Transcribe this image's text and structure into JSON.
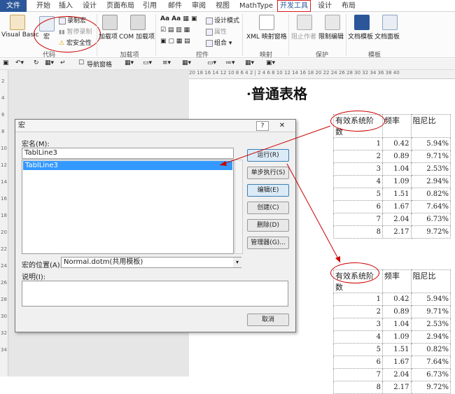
{
  "menu": {
    "file": "文件",
    "tabs": [
      "开始",
      "插入",
      "设计",
      "页面布局",
      "引用",
      "邮件",
      "审阅",
      "视图",
      "MathType",
      "开发工具",
      "设计",
      "布局"
    ]
  },
  "ribbon": {
    "code": {
      "visual_basic": "Visual Basic",
      "macro": "宏",
      "record_macro": "录制宏",
      "pause_recording": "暂停录制",
      "macro_security": "宏安全性",
      "label": "代码"
    },
    "addins": {
      "addins": "加载项",
      "com_addins": "COM 加载项",
      "label": "加载项"
    },
    "controls": {
      "design_mode": "设计模式",
      "properties": "属性",
      "group": "组合",
      "label": "控件"
    },
    "mapping": {
      "xml_pane": "XML 映射窗格",
      "label": "映射"
    },
    "protect": {
      "block_authors": "阻止作者",
      "restrict_editing": "限制编辑",
      "label": "保护"
    },
    "templates": {
      "doc_template": "文档模板",
      "doc_panel": "文档面板",
      "label": "模板"
    }
  },
  "qat": {
    "nav_pane": "导航窗格"
  },
  "ruler": {
    "h": "20 18 16 14 12 10 8 6 4 2 | 2 4 6 8 10 12 14 16 18 20 22 24 26 28 30 32 34 36 38 40",
    "v": [
      "2",
      "4",
      "6",
      "8",
      "10",
      "12",
      "14",
      "16",
      "18",
      "20",
      "22",
      "24",
      "26",
      "28",
      "30",
      "32",
      "34"
    ]
  },
  "document": {
    "title": "·普通表格",
    "tables": [
      {
        "headers": [
          "有效系统阶数",
          "频率",
          "阻尼比"
        ],
        "rows": [
          [
            "1",
            "0.42",
            "5.94%"
          ],
          [
            "2",
            "0.89",
            "9.71%"
          ],
          [
            "3",
            "1.04",
            "2.53%"
          ],
          [
            "4",
            "1.09",
            "2.94%"
          ],
          [
            "5",
            "1.51",
            "0.82%"
          ],
          [
            "6",
            "1.67",
            "7.64%"
          ],
          [
            "7",
            "2.04",
            "6.73%"
          ],
          [
            "8",
            "2.17",
            "9.72%"
          ]
        ]
      },
      {
        "headers": [
          "有效系统阶数",
          "频率",
          "阻尼比"
        ],
        "rows": [
          [
            "1",
            "0.42",
            "5.94%"
          ],
          [
            "2",
            "0.89",
            "9.71%"
          ],
          [
            "3",
            "1.04",
            "2.53%"
          ],
          [
            "4",
            "1.09",
            "2.94%"
          ],
          [
            "5",
            "1.51",
            "0.82%"
          ],
          [
            "6",
            "1.67",
            "7.64%"
          ],
          [
            "7",
            "2.04",
            "6.73%"
          ],
          [
            "8",
            "2.17",
            "9.72%"
          ]
        ]
      }
    ]
  },
  "dialog": {
    "title": "宏",
    "help": "?",
    "close": "✕",
    "macro_name_label": "宏名(M):",
    "macro_name_value": "TablLine3",
    "list_items": [
      "TablLine3"
    ],
    "location_label": "宏的位置(A):",
    "location_value": "Normal.dotm(共用模板)",
    "description_label": "说明(I):",
    "buttons": {
      "run": "运行(R)",
      "step": "单步执行(S)",
      "edit": "编辑(E)",
      "create": "创建(C)",
      "delete": "删除(D)",
      "organizer": "管理器(G)...",
      "cancel": "取消"
    }
  },
  "colors": {
    "file_tab": "#2b579a",
    "annotation": "#cc0000",
    "selection": "#3399ff"
  }
}
